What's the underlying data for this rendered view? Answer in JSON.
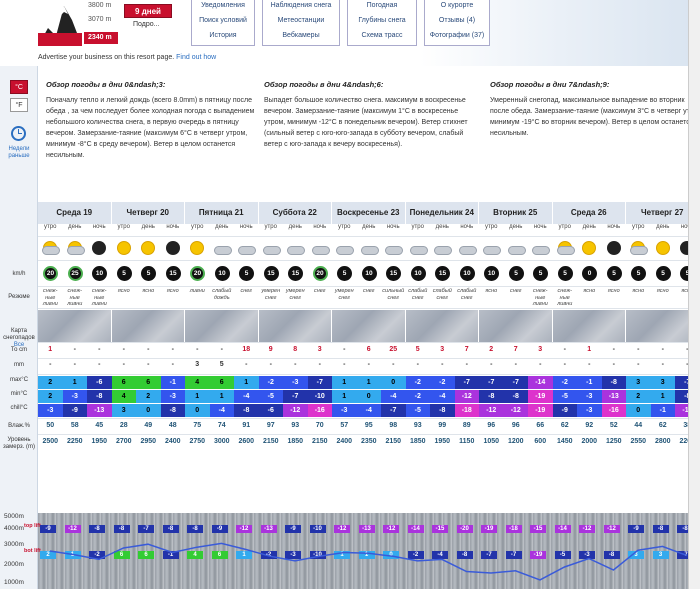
{
  "header": {
    "elevations": [
      "3800 m",
      "3070 m",
      "2340 m"
    ],
    "days_button": "9 дней",
    "podro": "Подро...",
    "nav_columns": [
      [
        "Уведомления",
        "Поиск условий",
        "История"
      ],
      [
        "Наблюдения снега",
        "Метеостанции",
        "Вебкамеры"
      ],
      [
        "Погодная",
        "Глубины снега",
        "Схема трасс"
      ],
      [
        "О курорте",
        "Отзывы (4)",
        "Фотографии (37)"
      ]
    ],
    "advert_text": "Advertise your business on this resort page.",
    "advert_link": "Find out how"
  },
  "toolbar": {
    "celsius": "°C",
    "fahrenheit": "°F",
    "weekly": "Недели раньше"
  },
  "summary": [
    {
      "title": "Обзор погоды в дни 0&ndash;3:",
      "text": "Поначалу тепло и легкий дождь (всего 8.0mm) в пятницу после обеда , за чем последует более холодная погода с выпадением небольшого количества снега, в первую очередь в пятницу вечером. Замерзание-таяние (максимум 6°C в четверг утром, минимум -8°C в среду вечером). Ветер в целом останется несильным."
    },
    {
      "title": "Обзор погоды в дни 4&ndash;6:",
      "text": "Выпадет большое количество снега. максимум в воскресенье вечером. Замерзание-таяние (максимум 1°C в воскресенье утром, минимум -12°C в понедельник вечером). Ветер стихнет (сильный ветер с юго-юго-запада в субботу вечером, слабый ветер с юго-запада к вечеру воскресенья)."
    },
    {
      "title": "Обзор погоды в дни 7&ndash;9:",
      "text": "Умеренный снегопад, максимальное выпадение во вторник после обеда. Замерзание-таяние (максимум 3°C в четверг утром, минимум -19°C во вторник вечером). Ветер в целом останется несильным."
    }
  ],
  "row_labels": {
    "wind": "km/h",
    "summary": "Резюме",
    "map": "Карта снегопадов",
    "map_all": "Все",
    "snow": "То cm",
    "rain": "mm",
    "max": "max°C",
    "min": "min°C",
    "chill": "chill°C",
    "hum": "Влаж.%",
    "fz": "Уровень замерз. (m)"
  },
  "days": [
    "Среда 19",
    "Четверг 20",
    "Пятница 21",
    "Суббота 22",
    "Воскресенье 23",
    "Понедельник 24",
    "Вторник 25",
    "Среда 26",
    "Четверг 27"
  ],
  "parts": [
    "утро",
    "день",
    "ночь"
  ],
  "icons": [
    "sun-cloud",
    "sun-cloud",
    "moon",
    "sun",
    "sun",
    "moon",
    "sun",
    "cloud",
    "cloud",
    "cloud",
    "cloud",
    "cloud",
    "cloud",
    "cloud",
    "cloud",
    "cloud",
    "cloud",
    "cloud",
    "cloud",
    "cloud",
    "cloud",
    "sun-cloud",
    "sun",
    "moon",
    "sun-cloud",
    "sun",
    "moon"
  ],
  "wind": [
    "20",
    "25",
    "10",
    "5",
    "5",
    "15",
    "20",
    "10",
    "5",
    "15",
    "15",
    "20",
    "5",
    "10",
    "15",
    "10",
    "15",
    "10",
    "10",
    "5",
    "5",
    "5",
    "0",
    "5",
    "5",
    "5",
    "5"
  ],
  "wind_gust": [
    true,
    true,
    false,
    false,
    false,
    false,
    true,
    false,
    false,
    false,
    false,
    true,
    false,
    false,
    false,
    false,
    false,
    false,
    false,
    false,
    false,
    false,
    false,
    false,
    false,
    false,
    false
  ],
  "summaries": [
    "снеж-ные ливни",
    "снеж-ные ливни",
    "снеж-ные ливни",
    "ясно",
    "ясно",
    "ясно",
    "ливни",
    "слабый дождь",
    "снег",
    "умерен снег",
    "умерен снег",
    "снег",
    "умерен снег",
    "снег",
    "сильный снег",
    "слабый снег",
    "слабый снег",
    "слабый снег",
    "ясно",
    "снег",
    "снеж-ные ливни",
    "снеж-ные ливни",
    "ясно",
    "ясно",
    "ясно",
    "ясно",
    "ясно"
  ],
  "snow": [
    "1",
    "-",
    "-",
    "-",
    "-",
    "-",
    "-",
    "-",
    "18",
    "9",
    "8",
    "3",
    "-",
    "6",
    "25",
    "5",
    "3",
    "7",
    "2",
    "7",
    "3",
    "-",
    "1",
    "-",
    "-",
    "-",
    "-"
  ],
  "rain": [
    "-",
    "-",
    "-",
    "-",
    "-",
    "-",
    "3",
    "5",
    "-",
    "-",
    "-",
    "-",
    "-",
    "-",
    "-",
    "-",
    "-",
    "-",
    "-",
    "-",
    "-",
    "-",
    "-",
    "-",
    "-",
    "-",
    "-"
  ],
  "tmax": [
    "2",
    "1",
    "-6",
    "6",
    "6",
    "-1",
    "4",
    "6",
    "1",
    "-2",
    "-3",
    "-7",
    "1",
    "1",
    "0",
    "-2",
    "-2",
    "-7",
    "-7",
    "-7",
    "-14",
    "-2",
    "-1",
    "-8",
    "3",
    "3",
    "-7"
  ],
  "tmin": [
    "2",
    "-3",
    "-8",
    "4",
    "2",
    "-3",
    "1",
    "1",
    "-4",
    "-5",
    "-7",
    "-10",
    "1",
    "0",
    "-4",
    "-2",
    "-4",
    "-12",
    "-8",
    "-8",
    "-19",
    "-5",
    "-3",
    "-13",
    "2",
    "1",
    "-8"
  ],
  "tchill": [
    "-3",
    "-9",
    "-13",
    "3",
    "0",
    "-8",
    "0",
    "-4",
    "-8",
    "-6",
    "-12",
    "-16",
    "-3",
    "-4",
    "-7",
    "-5",
    "-8",
    "-18",
    "-12",
    "-12",
    "-19",
    "-9",
    "-3",
    "-16",
    "0",
    "-1",
    "-11"
  ],
  "hum": [
    "50",
    "58",
    "45",
    "28",
    "49",
    "48",
    "75",
    "74",
    "91",
    "97",
    "93",
    "70",
    "57",
    "95",
    "98",
    "93",
    "99",
    "89",
    "96",
    "96",
    "66",
    "62",
    "92",
    "52",
    "44",
    "62",
    "38"
  ],
  "fz": [
    "2500",
    "2250",
    "1950",
    "2700",
    "2950",
    "2400",
    "2750",
    "3000",
    "2600",
    "2150",
    "1850",
    "2150",
    "2400",
    "2350",
    "2150",
    "1850",
    "1950",
    "1150",
    "1050",
    "1200",
    "600",
    "1450",
    "2000",
    "1250",
    "2550",
    "2800",
    "2200"
  ],
  "altitude": {
    "levels": [
      "5000m",
      "4000m",
      "3000m",
      "2000m",
      "1000m"
    ],
    "top_lift": "top lift",
    "bot_lift": "bot lift",
    "top_vals": [
      "-9",
      "-12",
      "-8",
      "-8",
      "-7",
      "-8",
      "-8",
      "-9",
      "-12",
      "-13",
      "-9",
      "-10",
      "-12",
      "-13",
      "-12",
      "-14",
      "-15",
      "-20",
      "-19",
      "-18",
      "-15",
      "-14",
      "-12",
      "-12",
      "-9",
      "-8",
      "-8"
    ],
    "bot_vals": [
      "2",
      "1",
      "-2",
      "6",
      "6",
      "-1",
      "4",
      "6",
      "1",
      "-2",
      "-3",
      "-10",
      "1",
      "1",
      "0",
      "-2",
      "-4",
      "-8",
      "-7",
      "-7",
      "-19",
      "-5",
      "-3",
      "-8",
      "3",
      "3",
      "-7"
    ]
  },
  "colors": {
    "accent": "#c8102e",
    "link": "#2a6ec0"
  }
}
